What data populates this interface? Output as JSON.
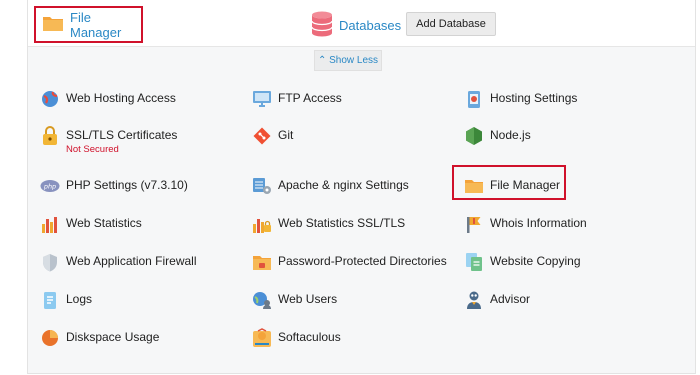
{
  "top": {
    "file_manager_label": "File Manager",
    "databases_label": "Databases",
    "add_database_button": "Add Database",
    "show_less": "⌃ Show Less"
  },
  "columns": {
    "col1": [
      {
        "label": "Web Hosting Access",
        "icon": "web-hosting-icon"
      },
      {
        "label": "SSL/TLS Certificates",
        "sublabel": "Not Secured",
        "icon": "lock-icon"
      },
      {
        "label": "PHP Settings (v7.3.10)",
        "icon": "php-icon"
      },
      {
        "label": "Web Statistics",
        "icon": "bar-chart-icon"
      },
      {
        "label": "Web Application Firewall",
        "icon": "shield-icon"
      },
      {
        "label": "Logs",
        "icon": "logs-icon"
      },
      {
        "label": "Diskspace Usage",
        "icon": "pie-chart-icon"
      }
    ],
    "col2": [
      {
        "label": "FTP Access",
        "icon": "ftp-icon"
      },
      {
        "label": "Git",
        "icon": "git-icon"
      },
      {
        "label": "Apache & nginx Settings",
        "icon": "server-gear-icon"
      },
      {
        "label": "Web Statistics SSL/TLS",
        "icon": "stats-lock-icon"
      },
      {
        "label": "Password-Protected Directories",
        "icon": "folder-lock-icon"
      },
      {
        "label": "Web Users",
        "icon": "users-icon"
      },
      {
        "label": "Softaculous",
        "icon": "softaculous-icon"
      }
    ],
    "col3": [
      {
        "label": "Hosting Settings",
        "icon": "settings-icon"
      },
      {
        "label": "Node.js",
        "icon": "nodejs-icon"
      },
      {
        "label": "File Manager",
        "icon": "folder-icon"
      },
      {
        "label": "Whois Information",
        "icon": "whois-icon"
      },
      {
        "label": "Website Copying",
        "icon": "copy-icon"
      },
      {
        "label": "Advisor",
        "icon": "advisor-icon"
      }
    ]
  },
  "colors": {
    "accent": "#2a88c5",
    "highlight": "#d0112b",
    "warning": "#d0112b"
  }
}
